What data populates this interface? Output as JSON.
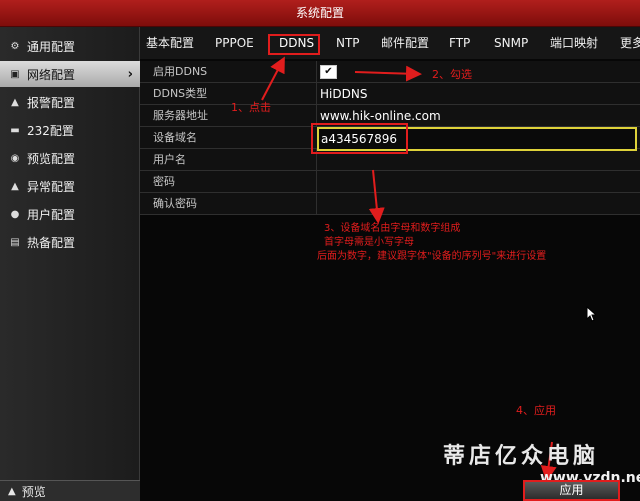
{
  "titlebar": {
    "title": "系统配置"
  },
  "sidebar": {
    "items": [
      {
        "icon": "gear-icon",
        "glyph": "⚙",
        "label": "通用配置"
      },
      {
        "icon": "network-icon",
        "glyph": "▣",
        "label": "网络配置",
        "active": true
      },
      {
        "icon": "alarm-icon",
        "glyph": "▲",
        "label": "报警配置"
      },
      {
        "icon": "serial-icon",
        "glyph": "▬",
        "label": "232配置"
      },
      {
        "icon": "eye-icon",
        "glyph": "◉",
        "label": "预览配置"
      },
      {
        "icon": "warning-icon",
        "glyph": "▲",
        "label": "异常配置"
      },
      {
        "icon": "user-icon",
        "glyph": "●",
        "label": "用户配置"
      },
      {
        "icon": "hotspare-icon",
        "glyph": "▤",
        "label": "热备配置"
      }
    ],
    "preview_label": "预览"
  },
  "tabs": [
    {
      "label": "基本配置"
    },
    {
      "label": "PPPOE"
    },
    {
      "label": "DDNS",
      "active": true
    },
    {
      "label": "NTP"
    },
    {
      "label": "邮件配置"
    },
    {
      "label": "FTP"
    },
    {
      "label": "SNMP"
    },
    {
      "label": "端口映射"
    },
    {
      "label": "更多"
    }
  ],
  "form": {
    "enable_ddns": {
      "label": "启用DDNS",
      "checked": true,
      "check_glyph": "✔"
    },
    "ddns_type": {
      "label": "DDNS类型",
      "value": "HiDDNS"
    },
    "server": {
      "label": "服务器地址",
      "value": "www.hik-online.com"
    },
    "domain": {
      "label": "设备域名",
      "value": "a434567896"
    },
    "username": {
      "label": "用户名",
      "value": ""
    },
    "password": {
      "label": "密码",
      "value": ""
    },
    "confirm": {
      "label": "确认密码",
      "value": ""
    }
  },
  "annotations": {
    "step1": "1、点击",
    "step2": "2、勾选",
    "step3_line1": "3、设备域名由字母和数字组成",
    "step3_line2": "首字母需是小写字母",
    "step3_line3": "后面为数字，建议跟字体\"设备的序列号\"来进行设置",
    "step4": "4、应用"
  },
  "apply_button": {
    "label": "应用"
  },
  "watermark": {
    "text": "蒂店亿众电脑",
    "url": "www.yzdn.net"
  },
  "colors": {
    "accent_red": "#e11d1d",
    "field_border": "#ded23a",
    "title_red": "#a3181a"
  }
}
